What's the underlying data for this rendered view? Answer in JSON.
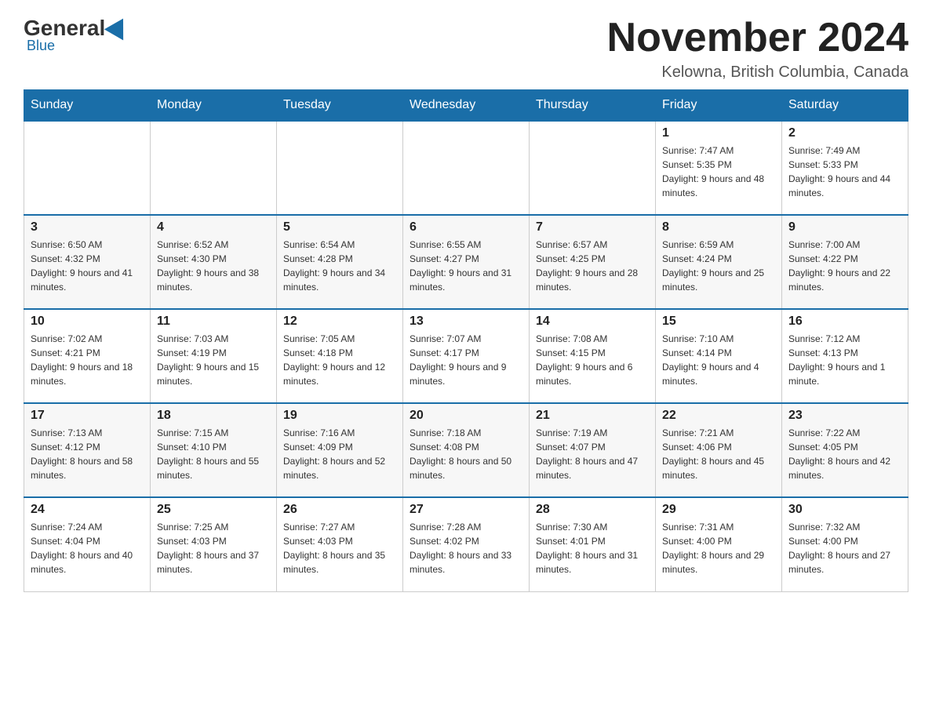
{
  "header": {
    "logo": {
      "general": "General",
      "blue": "Blue"
    },
    "title": "November 2024",
    "location": "Kelowna, British Columbia, Canada"
  },
  "weekdays": [
    "Sunday",
    "Monday",
    "Tuesday",
    "Wednesday",
    "Thursday",
    "Friday",
    "Saturday"
  ],
  "weeks": [
    [
      {
        "day": "",
        "info": ""
      },
      {
        "day": "",
        "info": ""
      },
      {
        "day": "",
        "info": ""
      },
      {
        "day": "",
        "info": ""
      },
      {
        "day": "",
        "info": ""
      },
      {
        "day": "1",
        "info": "Sunrise: 7:47 AM\nSunset: 5:35 PM\nDaylight: 9 hours and 48 minutes."
      },
      {
        "day": "2",
        "info": "Sunrise: 7:49 AM\nSunset: 5:33 PM\nDaylight: 9 hours and 44 minutes."
      }
    ],
    [
      {
        "day": "3",
        "info": "Sunrise: 6:50 AM\nSunset: 4:32 PM\nDaylight: 9 hours and 41 minutes."
      },
      {
        "day": "4",
        "info": "Sunrise: 6:52 AM\nSunset: 4:30 PM\nDaylight: 9 hours and 38 minutes."
      },
      {
        "day": "5",
        "info": "Sunrise: 6:54 AM\nSunset: 4:28 PM\nDaylight: 9 hours and 34 minutes."
      },
      {
        "day": "6",
        "info": "Sunrise: 6:55 AM\nSunset: 4:27 PM\nDaylight: 9 hours and 31 minutes."
      },
      {
        "day": "7",
        "info": "Sunrise: 6:57 AM\nSunset: 4:25 PM\nDaylight: 9 hours and 28 minutes."
      },
      {
        "day": "8",
        "info": "Sunrise: 6:59 AM\nSunset: 4:24 PM\nDaylight: 9 hours and 25 minutes."
      },
      {
        "day": "9",
        "info": "Sunrise: 7:00 AM\nSunset: 4:22 PM\nDaylight: 9 hours and 22 minutes."
      }
    ],
    [
      {
        "day": "10",
        "info": "Sunrise: 7:02 AM\nSunset: 4:21 PM\nDaylight: 9 hours and 18 minutes."
      },
      {
        "day": "11",
        "info": "Sunrise: 7:03 AM\nSunset: 4:19 PM\nDaylight: 9 hours and 15 minutes."
      },
      {
        "day": "12",
        "info": "Sunrise: 7:05 AM\nSunset: 4:18 PM\nDaylight: 9 hours and 12 minutes."
      },
      {
        "day": "13",
        "info": "Sunrise: 7:07 AM\nSunset: 4:17 PM\nDaylight: 9 hours and 9 minutes."
      },
      {
        "day": "14",
        "info": "Sunrise: 7:08 AM\nSunset: 4:15 PM\nDaylight: 9 hours and 6 minutes."
      },
      {
        "day": "15",
        "info": "Sunrise: 7:10 AM\nSunset: 4:14 PM\nDaylight: 9 hours and 4 minutes."
      },
      {
        "day": "16",
        "info": "Sunrise: 7:12 AM\nSunset: 4:13 PM\nDaylight: 9 hours and 1 minute."
      }
    ],
    [
      {
        "day": "17",
        "info": "Sunrise: 7:13 AM\nSunset: 4:12 PM\nDaylight: 8 hours and 58 minutes."
      },
      {
        "day": "18",
        "info": "Sunrise: 7:15 AM\nSunset: 4:10 PM\nDaylight: 8 hours and 55 minutes."
      },
      {
        "day": "19",
        "info": "Sunrise: 7:16 AM\nSunset: 4:09 PM\nDaylight: 8 hours and 52 minutes."
      },
      {
        "day": "20",
        "info": "Sunrise: 7:18 AM\nSunset: 4:08 PM\nDaylight: 8 hours and 50 minutes."
      },
      {
        "day": "21",
        "info": "Sunrise: 7:19 AM\nSunset: 4:07 PM\nDaylight: 8 hours and 47 minutes."
      },
      {
        "day": "22",
        "info": "Sunrise: 7:21 AM\nSunset: 4:06 PM\nDaylight: 8 hours and 45 minutes."
      },
      {
        "day": "23",
        "info": "Sunrise: 7:22 AM\nSunset: 4:05 PM\nDaylight: 8 hours and 42 minutes."
      }
    ],
    [
      {
        "day": "24",
        "info": "Sunrise: 7:24 AM\nSunset: 4:04 PM\nDaylight: 8 hours and 40 minutes."
      },
      {
        "day": "25",
        "info": "Sunrise: 7:25 AM\nSunset: 4:03 PM\nDaylight: 8 hours and 37 minutes."
      },
      {
        "day": "26",
        "info": "Sunrise: 7:27 AM\nSunset: 4:03 PM\nDaylight: 8 hours and 35 minutes."
      },
      {
        "day": "27",
        "info": "Sunrise: 7:28 AM\nSunset: 4:02 PM\nDaylight: 8 hours and 33 minutes."
      },
      {
        "day": "28",
        "info": "Sunrise: 7:30 AM\nSunset: 4:01 PM\nDaylight: 8 hours and 31 minutes."
      },
      {
        "day": "29",
        "info": "Sunrise: 7:31 AM\nSunset: 4:00 PM\nDaylight: 8 hours and 29 minutes."
      },
      {
        "day": "30",
        "info": "Sunrise: 7:32 AM\nSunset: 4:00 PM\nDaylight: 8 hours and 27 minutes."
      }
    ]
  ]
}
